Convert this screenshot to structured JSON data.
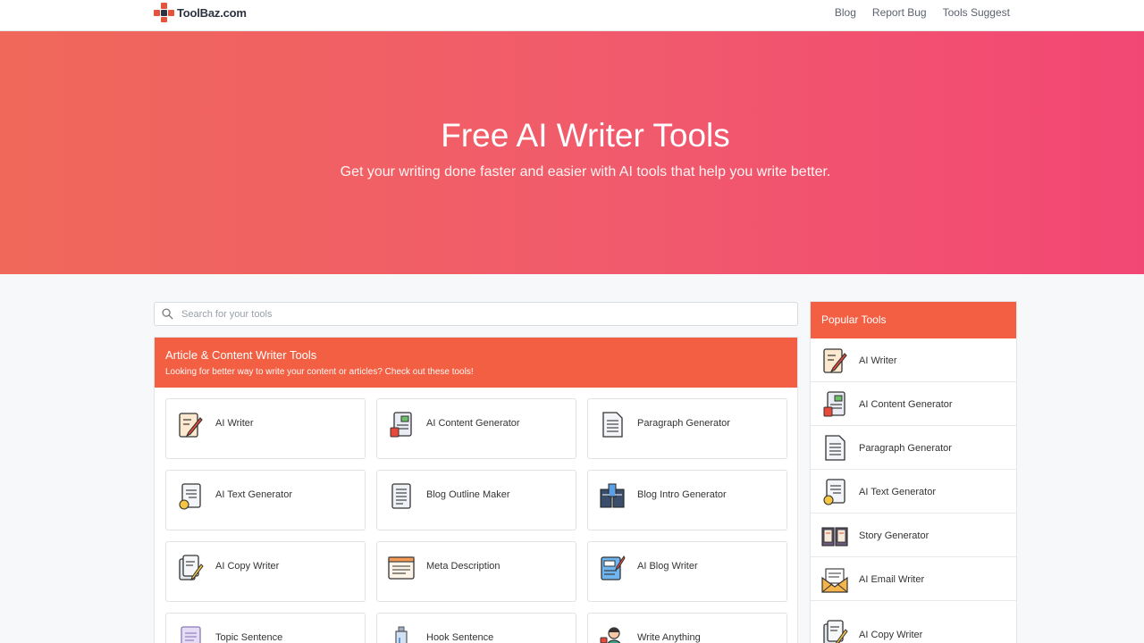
{
  "header": {
    "brand": "ToolBaz.com",
    "nav": [
      "Blog",
      "Report Bug",
      "Tools Suggest"
    ]
  },
  "hero": {
    "title": "Free AI Writer Tools",
    "subtitle": "Get your writing done faster and easier with AI tools that help you write better."
  },
  "search": {
    "placeholder": "Search for your tools"
  },
  "category": {
    "title": "Article & Content Writer Tools",
    "subtitle": "Looking for better way to write your content or articles? Check out these tools!",
    "tools": [
      {
        "label": "AI Writer",
        "icon": "pencil-notepad-icon"
      },
      {
        "label": "AI Content Generator",
        "icon": "content-doc-icon"
      },
      {
        "label": "Paragraph Generator",
        "icon": "paragraph-doc-icon"
      },
      {
        "label": "AI Text Generator",
        "icon": "text-doc-check-icon"
      },
      {
        "label": "Blog Outline Maker",
        "icon": "outline-doc-icon"
      },
      {
        "label": "Blog Intro Generator",
        "icon": "book-intro-icon"
      },
      {
        "label": "AI Copy Writer",
        "icon": "copy-pencil-icon"
      },
      {
        "label": "Meta Description",
        "icon": "code-window-icon"
      },
      {
        "label": "AI Blog Writer",
        "icon": "blog-pencil-icon"
      },
      {
        "label": "Topic Sentence",
        "icon": "topic-doc-icon"
      },
      {
        "label": "Hook Sentence",
        "icon": "hook-bottle-icon"
      },
      {
        "label": "Write Anything",
        "icon": "writer-person-icon"
      }
    ]
  },
  "popular": {
    "title": "Popular Tools",
    "items": [
      {
        "label": "AI Writer",
        "icon": "pencil-notepad-icon"
      },
      {
        "label": "AI Content Generator",
        "icon": "content-doc-icon"
      },
      {
        "label": "Paragraph Generator",
        "icon": "paragraph-doc-icon"
      },
      {
        "label": "AI Text Generator",
        "icon": "text-doc-check-icon"
      },
      {
        "label": "Story Generator",
        "icon": "story-book-icon"
      },
      {
        "label": "AI Email Writer",
        "icon": "email-envelope-icon"
      },
      {
        "label": "AI Copy Writer",
        "icon": "copy-pencil-icon"
      }
    ]
  },
  "colors": {
    "accent": "#f25f43",
    "hero_start": "#f0685a",
    "hero_end": "#f24774"
  }
}
